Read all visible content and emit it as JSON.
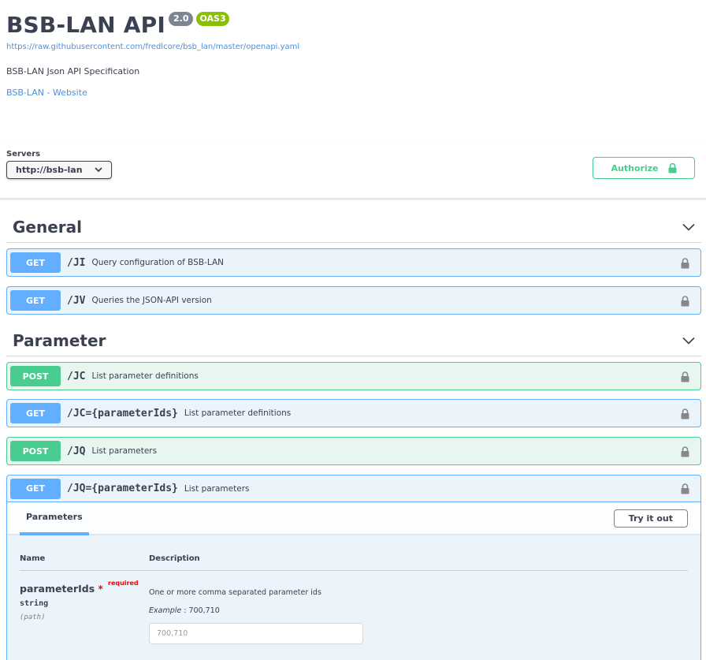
{
  "info": {
    "title": "BSB-LAN API",
    "version_badge": "2.0",
    "oas_badge": "OAS3",
    "spec_url": "https://raw.githubusercontent.com/fredlcore/bsb_lan/master/openapi.yaml",
    "description": "BSB-LAN Json API Specification",
    "website_link": "BSB-LAN - Website"
  },
  "servers": {
    "label": "Servers",
    "selected": "http://bsb-lan"
  },
  "authorize_label": "Authorize",
  "colors": {
    "get": "#61affe",
    "post": "#49cc90",
    "link": "#4990e2"
  },
  "tags": [
    {
      "name": "General",
      "operations": [
        {
          "method": "GET",
          "path": "/JI",
          "summary": "Query configuration of BSB-LAN"
        },
        {
          "method": "GET",
          "path": "/JV",
          "summary": "Queries the JSON-API version"
        }
      ]
    },
    {
      "name": "Parameter",
      "operations": [
        {
          "method": "POST",
          "path": "/JC",
          "summary": "List parameter definitions"
        },
        {
          "method": "GET",
          "path": "/JC={parameterIds}",
          "summary": "List parameter definitions"
        },
        {
          "method": "POST",
          "path": "/JQ",
          "summary": "List parameters"
        },
        {
          "method": "GET",
          "path": "/JQ={parameterIds}",
          "summary": "List parameters"
        }
      ]
    }
  ],
  "expanded_operation": {
    "tab_label": "Parameters",
    "try_it_out_label": "Try it out",
    "columns": [
      "Name",
      "Description"
    ],
    "parameter": {
      "name": "parameterIds",
      "required_marker": "*",
      "required_label": "required",
      "type": "string",
      "location": "(path)",
      "description": "One or more comma separated parameter ids",
      "example_label": "Example",
      "example_value": ": 700,710",
      "input_placeholder": "700,710"
    }
  }
}
